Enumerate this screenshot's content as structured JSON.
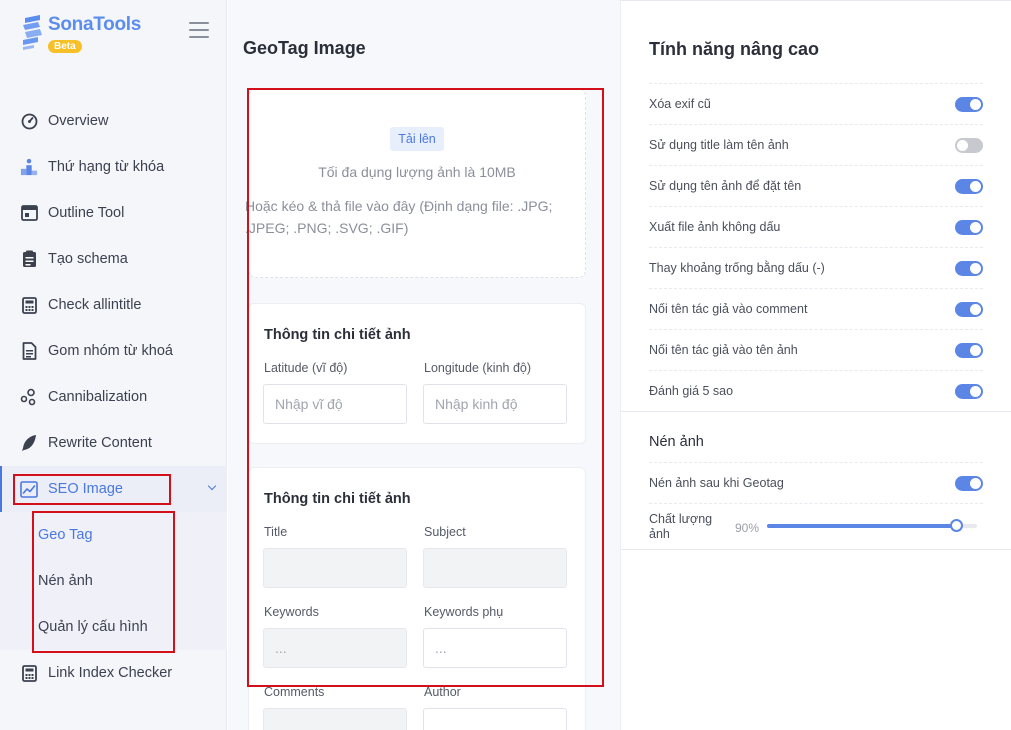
{
  "brand": {
    "name": "SonaTools",
    "badge": "Beta"
  },
  "sidebar": {
    "items": [
      {
        "label": "Overview",
        "icon": "gauge-icon"
      },
      {
        "label": "Thứ hạng từ khóa",
        "icon": "podium-icon"
      },
      {
        "label": "Outline Tool",
        "icon": "window-icon"
      },
      {
        "label": "Tạo schema",
        "icon": "clipboard-icon"
      },
      {
        "label": "Check allintitle",
        "icon": "calculator-icon"
      },
      {
        "label": "Gom nhóm từ khoá",
        "icon": "document-icon"
      },
      {
        "label": "Cannibalization",
        "icon": "molecule-icon"
      },
      {
        "label": "Rewrite Content",
        "icon": "feather-icon"
      },
      {
        "label": "SEO Image",
        "icon": "chart-image-icon"
      },
      {
        "label": "Link Index Checker",
        "icon": "calculator-icon"
      }
    ],
    "sub_items": [
      "Geo Tag",
      "Nén ảnh",
      "Quản lý cấu hình"
    ]
  },
  "main": {
    "title": "GeoTag Image",
    "upload": {
      "button": "Tải lên",
      "limit": "Tối đa dụng lượng ảnh là 10MB",
      "hint": "Hoặc kéo & thả file vào đây (Định dạng file: .JPG; .JPEG; .PNG; .SVG; .GIF)"
    },
    "location_card": {
      "title": "Thông tin chi tiết ảnh",
      "latitude_label": "Latitude (vĩ độ)",
      "latitude_placeholder": "Nhập vĩ độ",
      "longitude_label": "Longitude (kinh độ)",
      "longitude_placeholder": "Nhập kinh độ"
    },
    "details_card": {
      "title": "Thông tin chi tiết ảnh",
      "title_label": "Title",
      "subject_label": "Subject",
      "keywords_label": "Keywords",
      "keywords_placeholder": "...",
      "keywords_sub_label": "Keywords phụ",
      "keywords_sub_placeholder": "...",
      "comments_label": "Comments",
      "author_label": "Author"
    }
  },
  "advanced": {
    "title": "Tính năng nâng cao",
    "options": [
      {
        "label": "Xóa exif cũ",
        "on": true
      },
      {
        "label": "Sử dụng title làm tên ảnh",
        "on": false
      },
      {
        "label": "Sử dụng tên ảnh để đặt tên",
        "on": true
      },
      {
        "label": "Xuất file ảnh không dấu",
        "on": true
      },
      {
        "label": "Thay khoảng trống bằng dấu (-)",
        "on": true
      },
      {
        "label": "Nối tên tác giả vào comment",
        "on": true
      },
      {
        "label": "Nối tên tác giả vào tên ảnh",
        "on": true
      },
      {
        "label": "Đánh giá 5 sao",
        "on": true
      }
    ],
    "compress": {
      "title": "Nén ảnh",
      "option": {
        "label": "Nén ảnh sau khi Geotag",
        "on": true
      },
      "quality_label": "Chất lượng ảnh",
      "quality_value": "90%",
      "quality_fraction": 0.9
    }
  },
  "colors": {
    "accent": "#4a78e0",
    "toggle_on": "#5b86e5",
    "highlight": "#d3101a"
  }
}
